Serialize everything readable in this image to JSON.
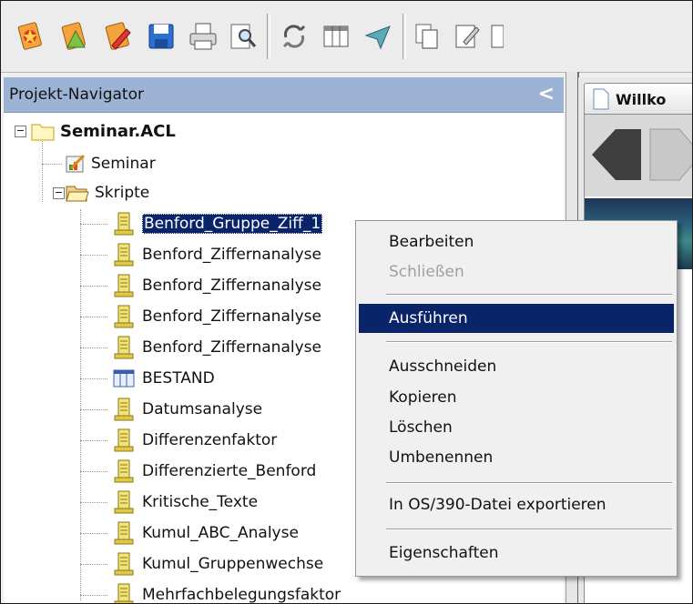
{
  "toolbar": {
    "icons": [
      "new-project-icon",
      "open-project-icon",
      "edit-project-icon",
      "save-icon",
      "print-icon",
      "search-icon",
      "refresh-icon",
      "table-view-icon",
      "filter-icon",
      "copy-icon",
      "notes-icon"
    ]
  },
  "navigator": {
    "title": "Projekt-Navigator",
    "collapse": "<",
    "project": "Seminar.ACL",
    "items": [
      {
        "label": "Seminar",
        "icon": "workspace-icon"
      },
      {
        "label": "Skripte",
        "icon": "folder-open-icon"
      },
      {
        "label": "Benford_Gruppe_Ziff_1",
        "icon": "script-icon"
      },
      {
        "label": "Benford_Ziffernanalyse",
        "icon": "script-icon"
      },
      {
        "label": "Benford_Ziffernanalyse",
        "icon": "script-icon"
      },
      {
        "label": "Benford_Ziffernanalyse",
        "icon": "script-icon"
      },
      {
        "label": "Benford_Ziffernanalyse",
        "icon": "script-icon"
      },
      {
        "label": "BESTAND",
        "icon": "table-icon"
      },
      {
        "label": "Datumsanalyse",
        "icon": "script-icon"
      },
      {
        "label": "Differenzenfaktor",
        "icon": "script-icon"
      },
      {
        "label": "Differenzierte_Benford",
        "icon": "script-icon"
      },
      {
        "label": "Kritische_Texte",
        "icon": "script-icon"
      },
      {
        "label": "Kumul_ABC_Analyse",
        "icon": "script-icon"
      },
      {
        "label": "Kumul_Gruppenwechse",
        "icon": "script-icon"
      },
      {
        "label": "Mehrfachbelegungsfaktor",
        "icon": "script-icon"
      }
    ]
  },
  "right_pane": {
    "tab_label": "Willko"
  },
  "context_menu": {
    "items": [
      {
        "label": "Bearbeiten",
        "state": "normal"
      },
      {
        "label": "Schließen",
        "state": "disabled"
      },
      {
        "label": "Ausführen",
        "state": "highlighted"
      },
      {
        "label": "Ausschneiden",
        "state": "normal"
      },
      {
        "label": "Kopieren",
        "state": "normal"
      },
      {
        "label": "Löschen",
        "state": "normal"
      },
      {
        "label": "Umbenennen",
        "state": "normal"
      },
      {
        "label": "In OS/390-Datei exportieren",
        "state": "normal"
      },
      {
        "label": "Eigenschaften",
        "state": "normal"
      }
    ]
  },
  "colors": {
    "selection": "#0a246a",
    "nav_header": "#9db3d6"
  }
}
